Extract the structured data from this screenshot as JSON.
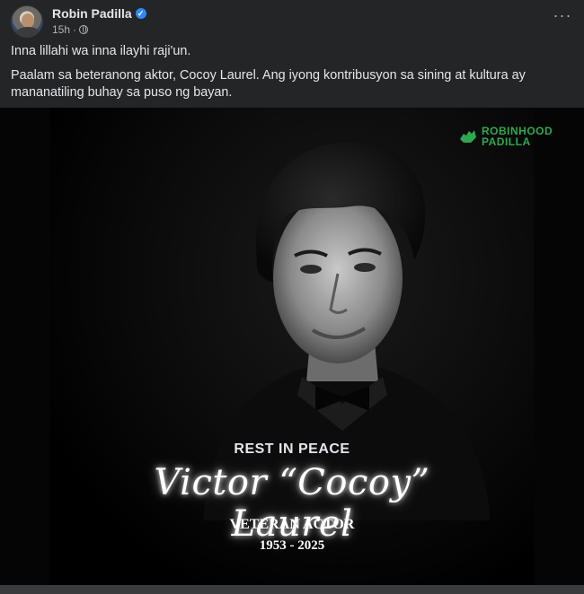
{
  "post": {
    "author": "Robin Padilla",
    "time": "15h",
    "visibility_icon": "globe-icon",
    "more_icon": "more-horizontal-icon",
    "more_label": "···",
    "paragraphs": [
      "Inna lillahi wa inna ilayhi raji'un.",
      "Paalam sa beteranong aktor, Cocoy Laurel. Ang iyong kontribusyon sa sining at kultura ay mananatiling buhay sa puso ng bayan."
    ]
  },
  "image": {
    "watermark_line1": "ROBINHOOD",
    "watermark_line2": "PADILLA",
    "rest_in_peace": "REST IN PEACE",
    "name": "Victor “Cocoy” Laurel",
    "role": "VETERAN ACTOR",
    "years": "1953 - 2025"
  },
  "colors": {
    "background": "#242526",
    "text": "#e4e6eb",
    "secondary": "#b0b3b8",
    "verified": "#2d88ff",
    "watermark_green": "#2fa84f"
  }
}
